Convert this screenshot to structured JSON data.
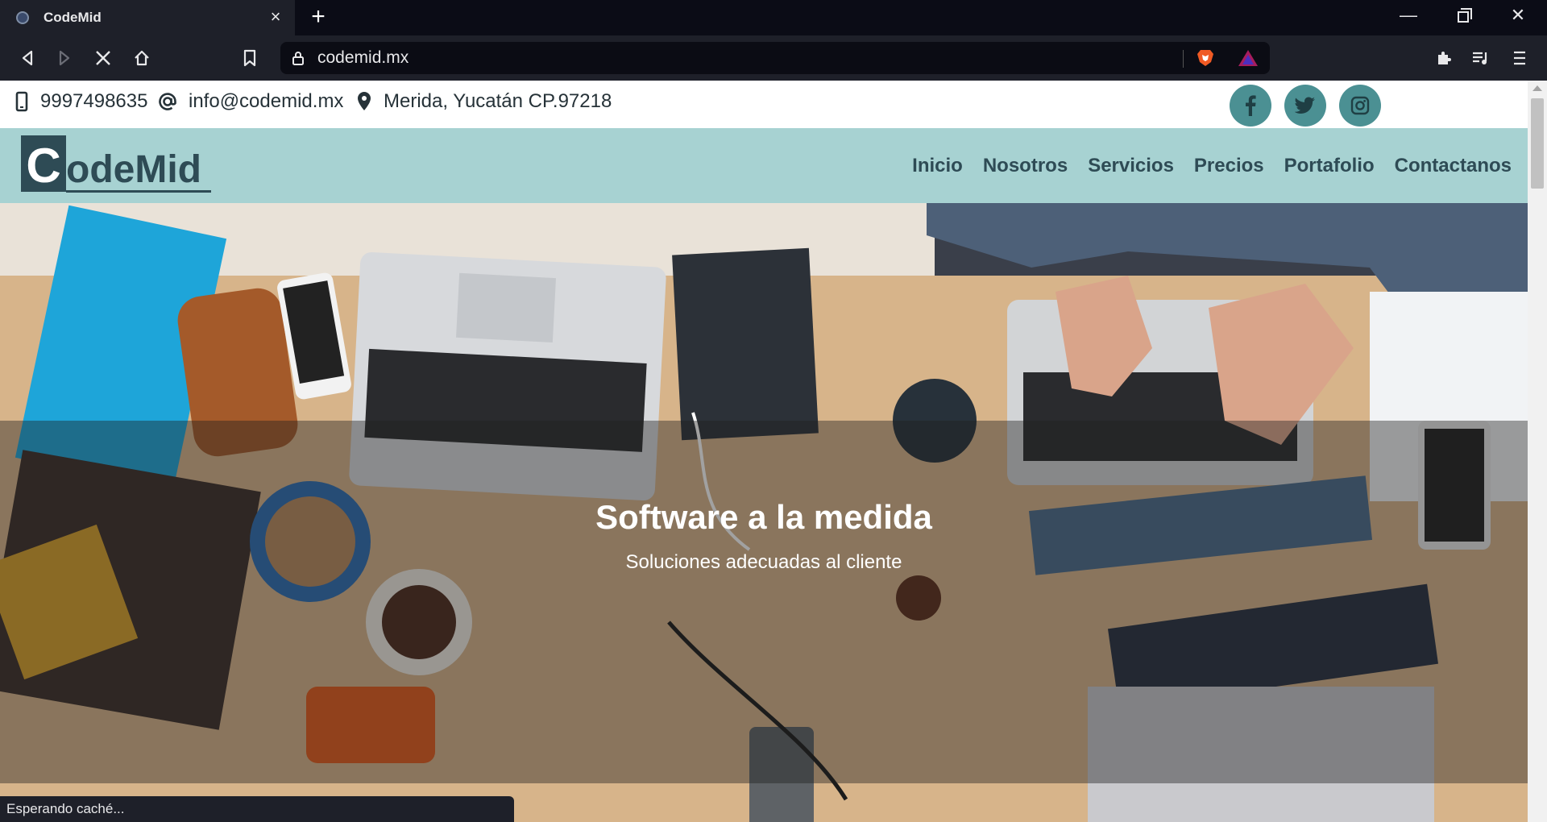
{
  "browser": {
    "tab_title": "CodeMid",
    "url": "codemid.mx",
    "status_text": "Esperando caché..."
  },
  "contact": {
    "phone": "9997498635",
    "email": "info@codemid.mx",
    "address": "Merida, Yucatán CP.97218"
  },
  "social": [
    "facebook",
    "twitter",
    "instagram"
  ],
  "logo": {
    "text": "CodeMid"
  },
  "nav": {
    "items": [
      "Inicio",
      "Nosotros",
      "Servicios",
      "Precios",
      "Portafolio",
      "Contactanos"
    ]
  },
  "hero": {
    "title": "Software a la medida",
    "subtitle": "Soluciones adecuadas al cliente"
  },
  "colors": {
    "navbar_bg": "#a7d2d2",
    "social_bg": "#4b9093",
    "nav_text": "#2e4b55",
    "browser_chrome": "#1e2029"
  }
}
